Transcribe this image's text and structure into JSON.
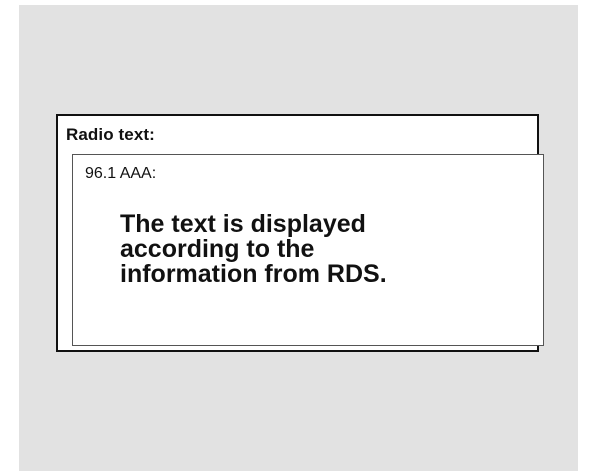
{
  "panel": {
    "title": "Radio text:",
    "station": "96.1 AAA:",
    "message_lines": [
      "The text is displayed",
      "according to the",
      "information from RDS."
    ]
  },
  "colors": {
    "screen_background": "#e2e2e2",
    "panel_background": "#ffffff",
    "text": "#111111"
  }
}
